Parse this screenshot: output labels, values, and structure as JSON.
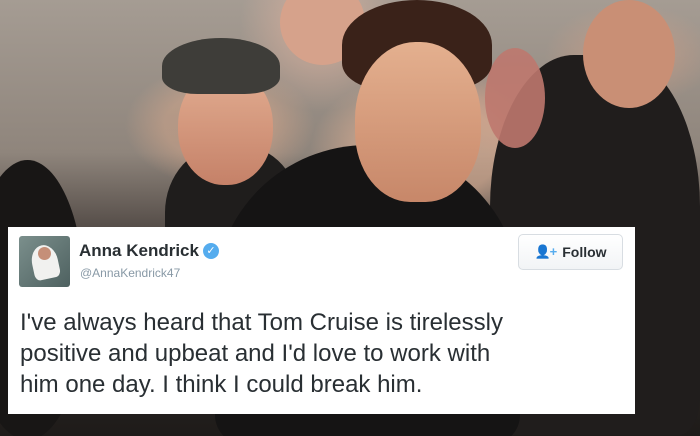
{
  "tweet": {
    "display_name": "Anna Kendrick",
    "handle": "@AnnaKendrick47",
    "follow_label": "Follow",
    "text": "I've always heard that Tom Cruise is tirelessly\npositive and upbeat and I'd love to work with\nhim one day. I think I could break him."
  },
  "colors": {
    "verified_badge": "#55acee",
    "handle_gray": "#8899a6",
    "text_dark": "#292f33"
  },
  "icons": {
    "verified": "verified-badge-icon",
    "follow": "add-user-icon"
  }
}
